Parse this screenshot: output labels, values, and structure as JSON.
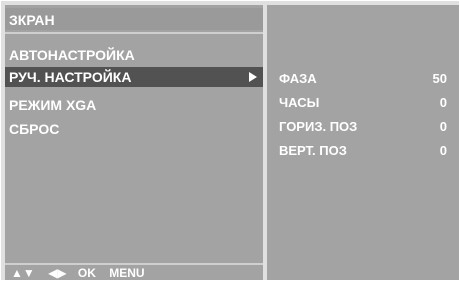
{
  "menu": {
    "title": "ЗКРАН",
    "items": [
      {
        "label": "АВТОНАСТРОЙКА"
      },
      {
        "label": "РУЧ. НАСТРОЙКА"
      },
      {
        "label": "РЕЖИМ XGA"
      },
      {
        "label": "СБРОС"
      }
    ],
    "selected_index": 1
  },
  "nav": {
    "updown_glyph": "▲▼",
    "leftright_glyph": "◀▶",
    "ok_label": "OK",
    "menu_label": "MENU"
  },
  "params": [
    {
      "name": "ФАЗА",
      "value": "50"
    },
    {
      "name": "ЧАСЫ",
      "value": "0"
    },
    {
      "name": "ГОРИЗ. ПОЗ",
      "value": "0"
    },
    {
      "name": "ВЕРТ. ПОЗ",
      "value": "0"
    }
  ],
  "colors": {
    "panel": "#a3a3a3",
    "selected": "#525252",
    "text": "#ffffff"
  }
}
